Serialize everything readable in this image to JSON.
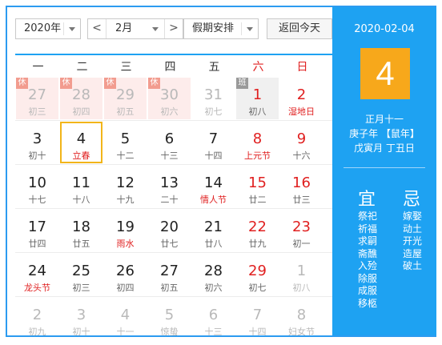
{
  "toolbar": {
    "year": "2020年",
    "month": "2月",
    "prev_glyph": "<",
    "next_glyph": ">",
    "holiday": "假期安排",
    "today": "返回今天"
  },
  "weekdays": [
    {
      "label": "一",
      "weekend": false
    },
    {
      "label": "二",
      "weekend": false
    },
    {
      "label": "三",
      "weekend": false
    },
    {
      "label": "四",
      "weekend": false
    },
    {
      "label": "五",
      "weekend": false
    },
    {
      "label": "六",
      "weekend": true
    },
    {
      "label": "日",
      "weekend": true
    }
  ],
  "weeks": [
    [
      {
        "d": "27",
        "l": "初三",
        "other": true,
        "tag": "休",
        "holiday": true
      },
      {
        "d": "28",
        "l": "初四",
        "other": true,
        "tag": "休",
        "holiday": true
      },
      {
        "d": "29",
        "l": "初五",
        "other": true,
        "tag": "休",
        "holiday": true
      },
      {
        "d": "30",
        "l": "初六",
        "other": true,
        "tag": "休",
        "holiday": true
      },
      {
        "d": "31",
        "l": "初七",
        "other": true
      },
      {
        "d": "1",
        "l": "初八",
        "we": true,
        "tag": "班",
        "work": true
      },
      {
        "d": "2",
        "l": "湿地日",
        "we": true,
        "fest": true
      }
    ],
    [
      {
        "d": "3",
        "l": "初十"
      },
      {
        "d": "4",
        "l": "立春",
        "fest": true,
        "selected": true
      },
      {
        "d": "5",
        "l": "十二"
      },
      {
        "d": "6",
        "l": "十三"
      },
      {
        "d": "7",
        "l": "十四"
      },
      {
        "d": "8",
        "l": "上元节",
        "we": true,
        "fest": true
      },
      {
        "d": "9",
        "l": "十六",
        "we": true
      }
    ],
    [
      {
        "d": "10",
        "l": "十七"
      },
      {
        "d": "11",
        "l": "十八"
      },
      {
        "d": "12",
        "l": "十九"
      },
      {
        "d": "13",
        "l": "二十"
      },
      {
        "d": "14",
        "l": "情人节",
        "fest": true
      },
      {
        "d": "15",
        "l": "廿二",
        "we": true
      },
      {
        "d": "16",
        "l": "廿三",
        "we": true
      }
    ],
    [
      {
        "d": "17",
        "l": "廿四"
      },
      {
        "d": "18",
        "l": "廿五"
      },
      {
        "d": "19",
        "l": "雨水",
        "fest": true
      },
      {
        "d": "20",
        "l": "廿七"
      },
      {
        "d": "21",
        "l": "廿八"
      },
      {
        "d": "22",
        "l": "廿九",
        "we": true
      },
      {
        "d": "23",
        "l": "初一",
        "we": true
      }
    ],
    [
      {
        "d": "24",
        "l": "龙头节",
        "fest": true
      },
      {
        "d": "25",
        "l": "初三"
      },
      {
        "d": "26",
        "l": "初四"
      },
      {
        "d": "27",
        "l": "初五"
      },
      {
        "d": "28",
        "l": "初六"
      },
      {
        "d": "29",
        "l": "初七",
        "we": true
      },
      {
        "d": "1",
        "l": "初八",
        "other": true
      }
    ],
    [
      {
        "d": "2",
        "l": "初九",
        "other": true
      },
      {
        "d": "3",
        "l": "初十",
        "other": true
      },
      {
        "d": "4",
        "l": "十一",
        "other": true
      },
      {
        "d": "5",
        "l": "惊蛰",
        "other": true
      },
      {
        "d": "6",
        "l": "十三",
        "other": true
      },
      {
        "d": "7",
        "l": "十四",
        "other": true
      },
      {
        "d": "8",
        "l": "妇女节",
        "other": true
      }
    ]
  ],
  "panel": {
    "date": "2020-02-04",
    "day": "4",
    "lunar": "正月十一",
    "ganzhi_year": "庚子年 【鼠年】",
    "ganzhi_month_day": "戊寅月 丁丑日",
    "yi_label": "宜",
    "ji_label": "忌",
    "yi": [
      "祭祀",
      "祈福",
      "求嗣",
      "斋醮",
      "入殓",
      "除服",
      "成服",
      "移柩"
    ],
    "ji": [
      "嫁娶",
      "动土",
      "开光",
      "造屋",
      "破土"
    ]
  },
  "colors": {
    "accent": "#1ea2f2",
    "selected_border": "#f2b51a",
    "red": "#e02020",
    "big_day_bg": "#f7a81b"
  }
}
